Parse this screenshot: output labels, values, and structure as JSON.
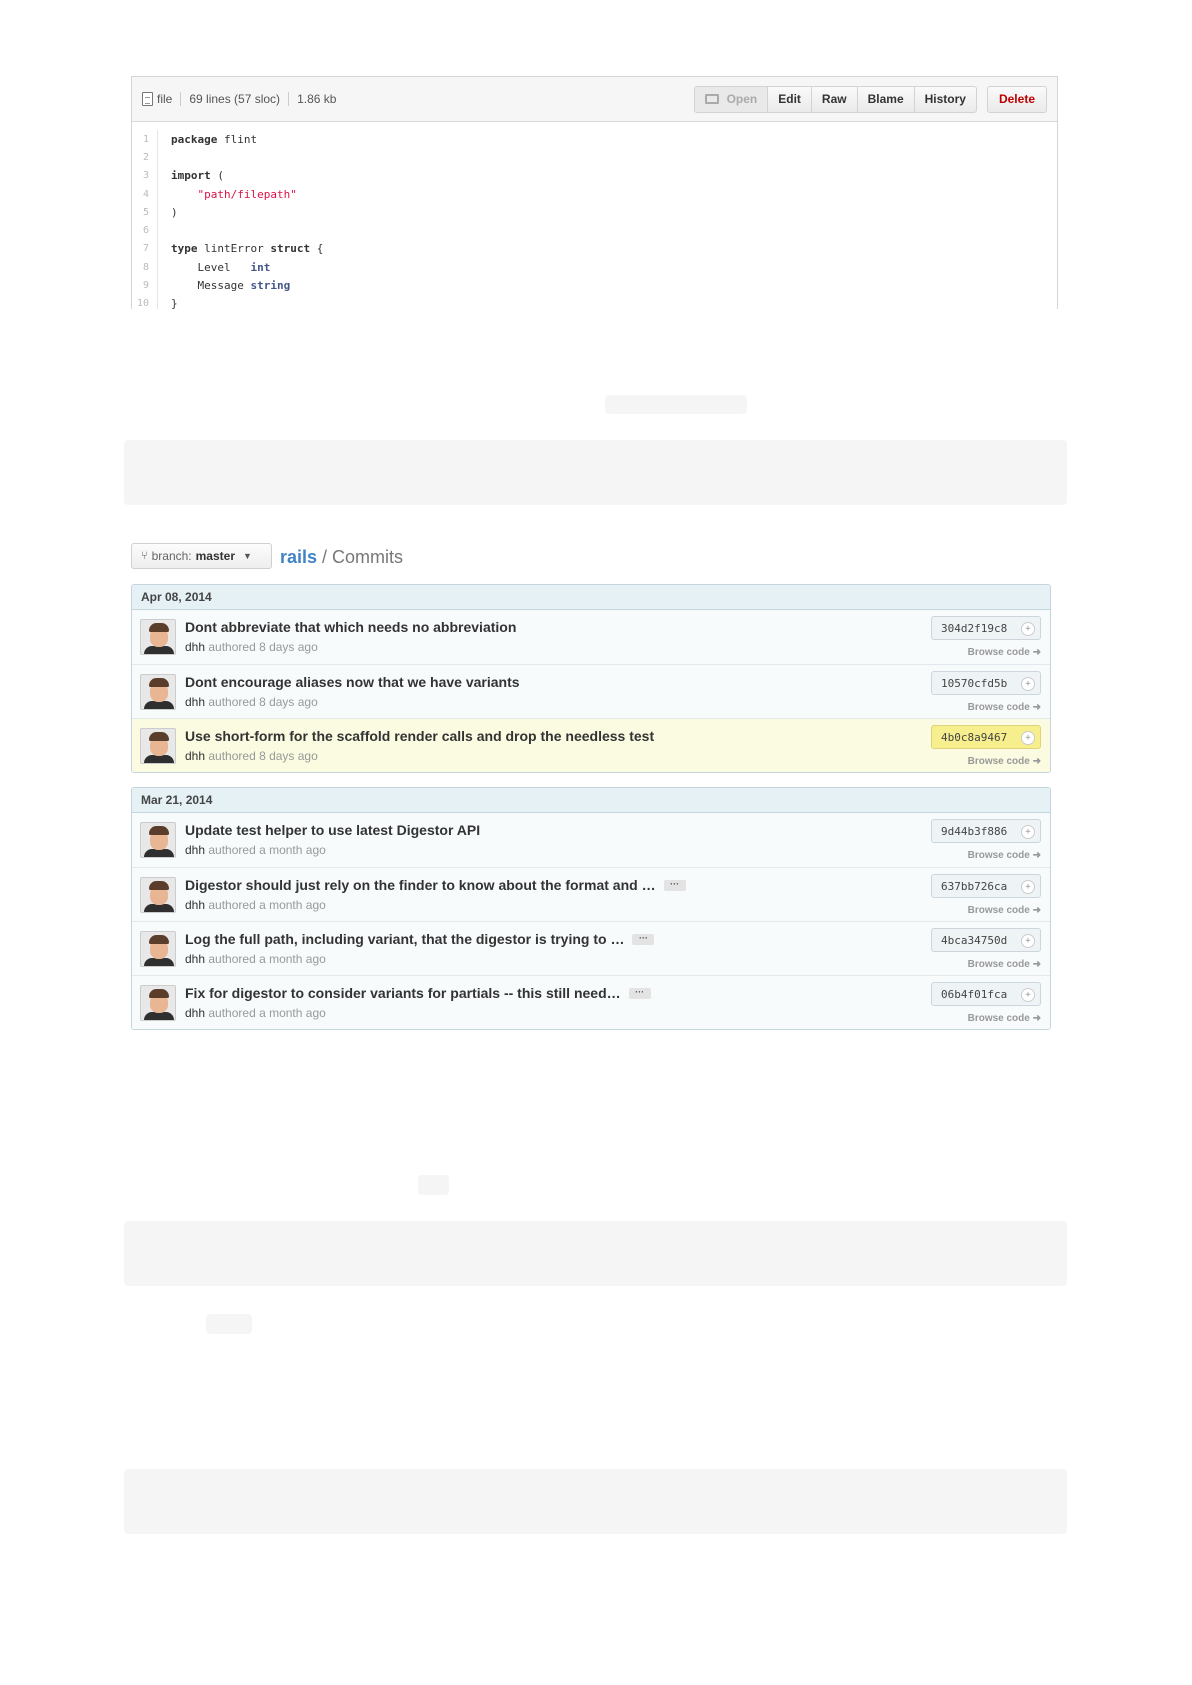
{
  "file_header": {
    "file_label": "file",
    "lines": "69 lines (57 sloc)",
    "size": "1.86 kb",
    "actions": {
      "open": "Open",
      "edit": "Edit",
      "raw": "Raw",
      "blame": "Blame",
      "history": "History",
      "delete": "Delete"
    }
  },
  "code": {
    "line_numbers": [
      "1",
      "2",
      "3",
      "4",
      "5",
      "6",
      "7",
      "8",
      "9",
      "10"
    ],
    "l1": {
      "kw": "package",
      "rest": " flint"
    },
    "l3": {
      "kw": "import",
      "rest": " ("
    },
    "l4": {
      "str": "\"path/filepath\""
    },
    "l5": ")",
    "l7": {
      "kw1": "type",
      "mid": " lintError ",
      "kw2": "struct",
      "rest": " {"
    },
    "l8": {
      "name": "Level   ",
      "type": "int"
    },
    "l9": {
      "name": "Message ",
      "type": "string"
    },
    "l10": "}"
  },
  "toolbar": {
    "branch_label": "branch:",
    "branch_name": "master",
    "repo": "rails",
    "separator": " / ",
    "page": "Commits"
  },
  "groups": [
    {
      "date": "Apr 08, 2014",
      "commits": [
        {
          "title": "Dont abbreviate that which needs no abbreviation",
          "author": "dhh",
          "meta": " authored 8 days ago",
          "sha": "304d2f19c8",
          "browse": "Browse code ➜"
        },
        {
          "title": "Dont encourage aliases now that we have variants",
          "author": "dhh",
          "meta": " authored 8 days ago",
          "sha": "10570cfd5b",
          "browse": "Browse code ➜"
        },
        {
          "title": "Use short-form for the scaffold render calls and drop the needless test",
          "author": "dhh",
          "meta": " authored 8 days ago",
          "sha": "4b0c8a9467",
          "browse": "Browse code ➜"
        }
      ]
    },
    {
      "date": "Mar 21, 2014",
      "commits": [
        {
          "title": "Update test helper to use latest Digestor API",
          "author": "dhh",
          "meta": " authored a month ago",
          "sha": "9d44b3f886",
          "browse": "Browse code ➜"
        },
        {
          "title": "Digestor should just rely on the finder to know about the format and …",
          "author": "dhh",
          "meta": " authored a month ago",
          "sha": "637bb726ca",
          "browse": "Browse code ➜"
        },
        {
          "title": "Log the full path, including variant, that the digestor is trying to …",
          "author": "dhh",
          "meta": " authored a month ago",
          "sha": "4bca34750d",
          "browse": "Browse code ➜"
        },
        {
          "title": "Fix for digestor to consider variants for partials -- this still need…",
          "author": "dhh",
          "meta": " authored a month ago",
          "sha": "06b4f01fca",
          "browse": "Browse code ➜"
        }
      ]
    }
  ],
  "ellipsis_label": "···",
  "copy_icon": "+"
}
